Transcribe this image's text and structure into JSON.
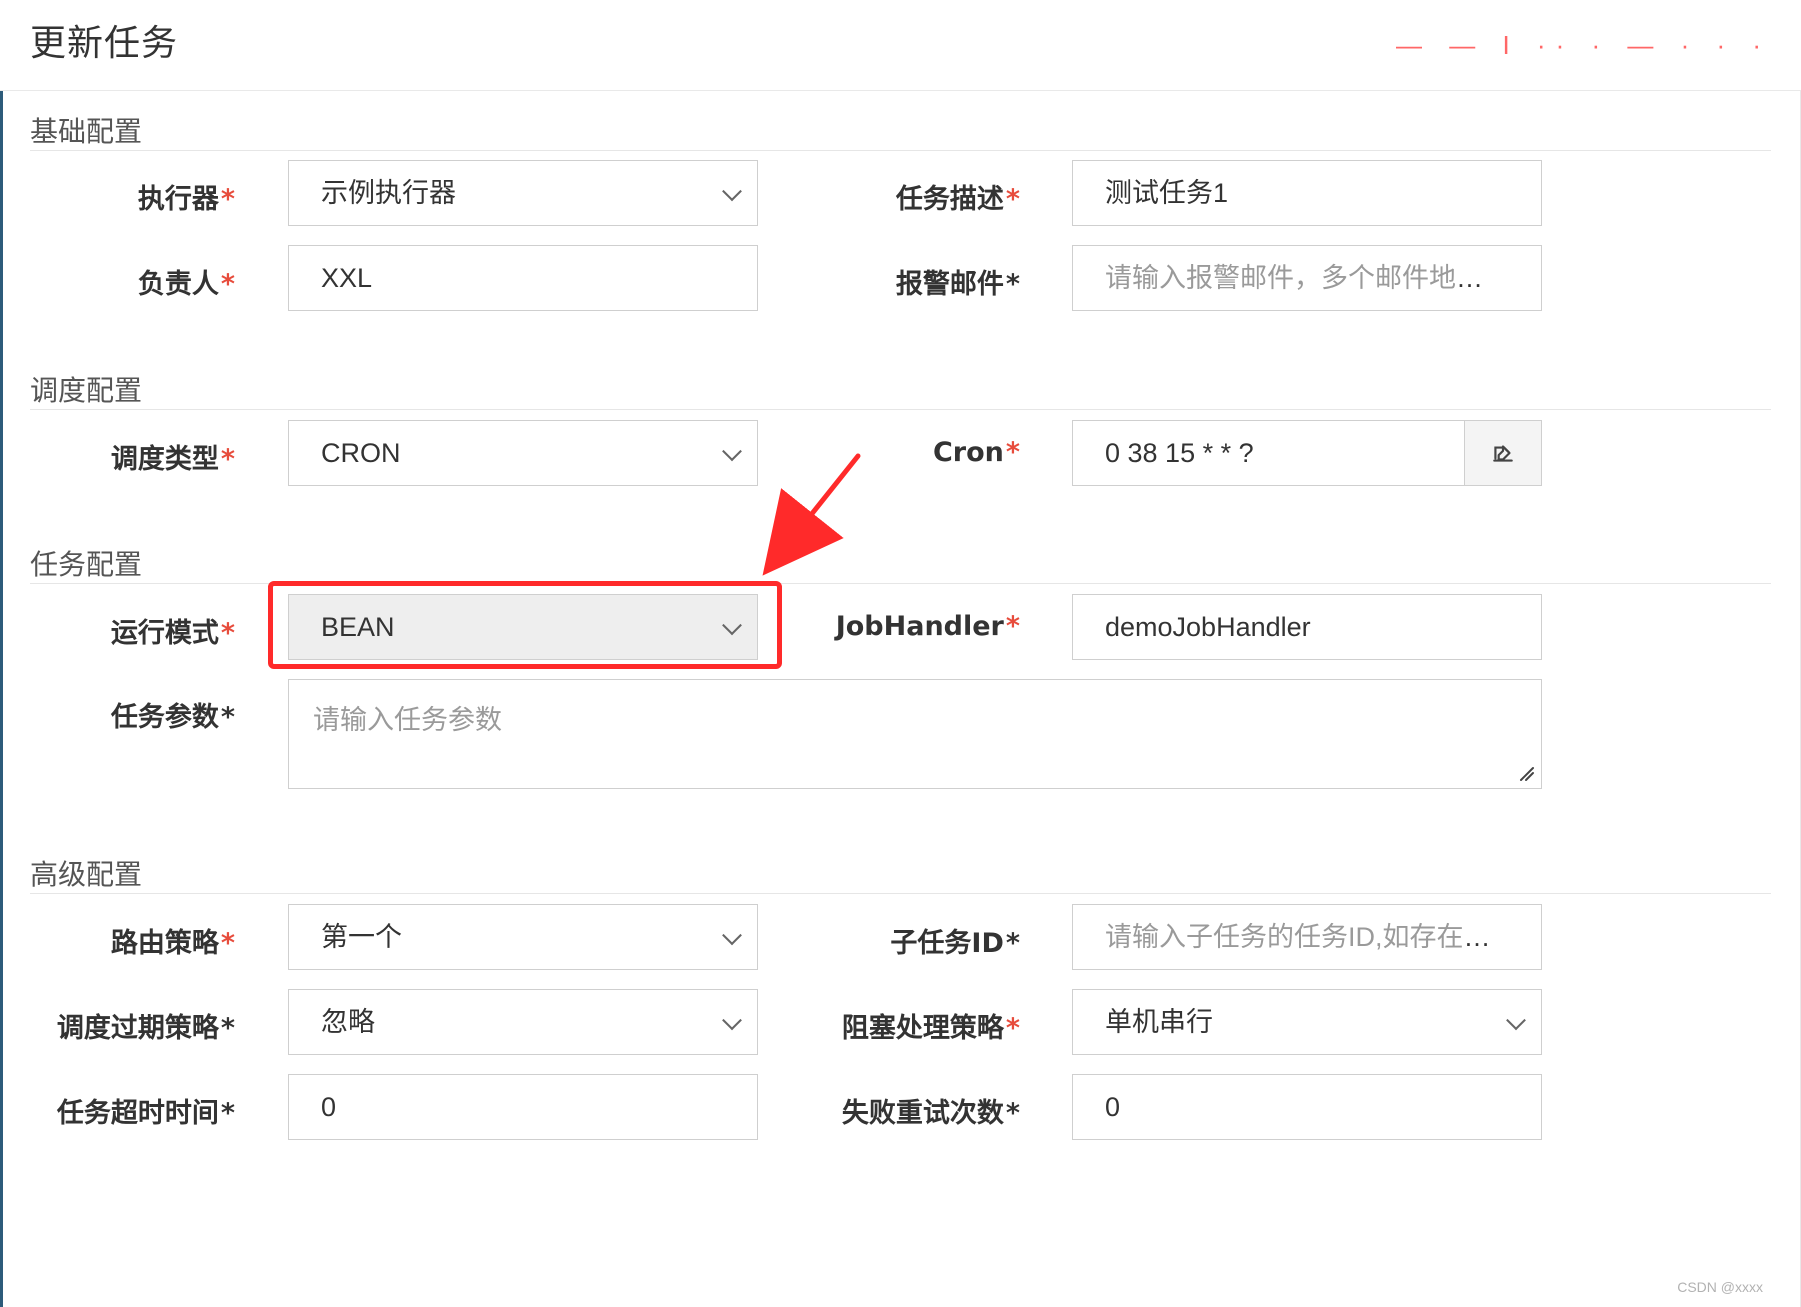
{
  "header": {
    "title": "更新任务",
    "brand_fragment": "— — I ·· · — · · ·"
  },
  "sections": {
    "basic": "基础配置",
    "schedule": "调度配置",
    "task": "任务配置",
    "advanced": "高级配置"
  },
  "fields": {
    "executor": {
      "label": "执行器",
      "required_mark": "*",
      "value": "示例执行器"
    },
    "task_desc": {
      "label": "任务描述",
      "required_mark": "*",
      "value": "测试任务1"
    },
    "owner": {
      "label": "负责人",
      "required_mark": "*",
      "value": "XXL"
    },
    "alarm_email": {
      "label": "报警邮件",
      "required_mark": "*",
      "placeholder": "请输入报警邮件，多个邮件地址则逗号分"
    },
    "schedule_type": {
      "label": "调度类型",
      "required_mark": "*",
      "value": "CRON"
    },
    "cron": {
      "label": "Cron",
      "required_mark": "*",
      "value": "0 38 15 * * ?"
    },
    "run_mode": {
      "label": "运行模式",
      "required_mark": "*",
      "value": "BEAN"
    },
    "job_handler": {
      "label": "JobHandler",
      "required_mark": "*",
      "value": "demoJobHandler"
    },
    "task_params": {
      "label": "任务参数",
      "required_mark": "*",
      "placeholder": "请输入任务参数"
    },
    "route_strategy": {
      "label": "路由策略",
      "required_mark": "*",
      "value": "第一个"
    },
    "child_job_id": {
      "label": "子任务ID",
      "required_mark": "*",
      "placeholder": "请输入子任务的任务ID,如存在多个则逗号分隔"
    },
    "misfire_strategy": {
      "label": "调度过期策略",
      "required_mark": "*",
      "value": "忽略"
    },
    "block_strategy": {
      "label": "阻塞处理策略",
      "required_mark": "*",
      "value": "单机串行"
    },
    "timeout": {
      "label": "任务超时时间",
      "required_mark": "*",
      "value": "0"
    },
    "retry_count": {
      "label": "失败重试次数",
      "required_mark": "*",
      "value": "0"
    }
  },
  "icons": {
    "cron_edit": "edit-icon",
    "chevron": "chevron-down-icon",
    "resize": "resize-handle-icon"
  },
  "colors": {
    "required": "#e74c3c",
    "annotation": "#ff2a2a"
  },
  "watermark": "CSDN @xxxx"
}
